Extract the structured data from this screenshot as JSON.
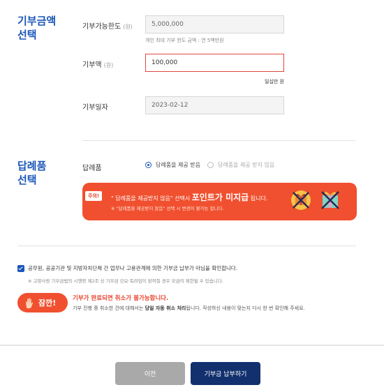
{
  "sections": {
    "amount_title": "기부금액\n선택",
    "gift_title": "답례품\n선택"
  },
  "amount": {
    "limit_label": "기부가능한도",
    "limit_unit": "(원)",
    "limit_value": "5,000,000",
    "limit_hint": "개인 최대 기부 한도 금액 : 연 5백만원",
    "donation_label": "기부액",
    "donation_unit": "(원)",
    "donation_value": "100,000",
    "donation_korean": "일십만 원",
    "date_label": "기부일자",
    "date_value": "2023-02-12"
  },
  "gift": {
    "label": "답례품",
    "option_receive": "답례품을 제공 받음",
    "option_decline": "답례품을 제공 받지 않음",
    "selected": "option_receive",
    "banner_tag": "주의!",
    "banner_line1_pre": "\" 답례품을 제공받지 않음\" 선택시",
    "banner_line1_bold": "포인트가 미지급",
    "banner_line1_post": "됩니다.",
    "banner_line2": "※ \"답례품을 제공받지 않음\" 선택 시 변경이 불가능 합니다.",
    "gift_icons": [
      "gift-box-crossed-icon",
      "gift-box-crossed-icon"
    ]
  },
  "agreement": {
    "checked": true,
    "text": "공무원, 공공기관 및 지방자치단체 간 업무나 고용관계에 의한 기부금 납부가 아님을 확인합니다.",
    "note": "※ 고향사랑 기부금법의 시행령 제2조 상 기부금 강요·독려임이 밝혀질 경우 모금이 제한될 수 있습니다."
  },
  "notice": {
    "badge": "잠깐!",
    "line1": "기부가 완료되면 취소가 불가능합니다.",
    "line2_pre": "기부 진행 중 취소한 건에 대해서는",
    "line2_bold": "당일 자동 취소 처리",
    "line2_post": "됩니다. 작성하신 내용이 맞는지 다시 한 번 확인해 주세요."
  },
  "buttons": {
    "prev": "이전",
    "submit": "기부금 납부하기"
  },
  "colors": {
    "accent_blue": "#1a56b8",
    "warning_orange": "#f0502f",
    "submit_navy": "#12306e",
    "prev_gray": "#a9a9a9"
  }
}
